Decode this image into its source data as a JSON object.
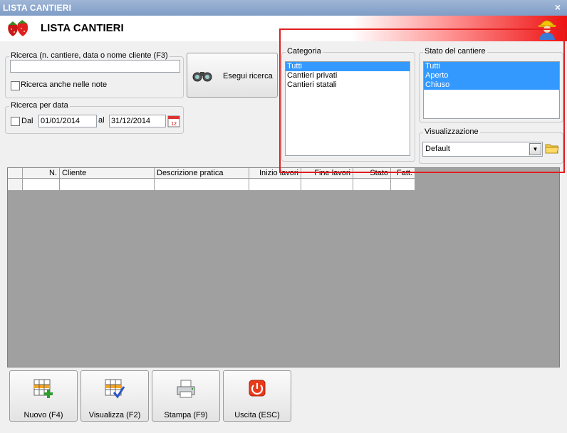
{
  "window": {
    "title": "LISTA CANTIERI",
    "close_glyph": "×"
  },
  "header": {
    "title": "LISTA CANTIERI",
    "logo_icon": "strawberries-icon",
    "user_icon": "worker-helmet-icon"
  },
  "search": {
    "legend": "Ricerca (n. cantiere, data o nome cliente (F3)",
    "value": "",
    "notes_checkbox_label": "Ricerca anche nelle note",
    "notes_checked": false,
    "button_label": "Esegui ricerca",
    "button_icon": "binoculars-icon"
  },
  "date_search": {
    "legend": "Ricerca per data",
    "dal_label": "Dal",
    "dal_checked": false,
    "from": "01/01/2014",
    "al_label": "al",
    "to": "31/12/2014",
    "calendar_icon": "calendar-icon"
  },
  "categoria": {
    "legend": "Categoria",
    "items": [
      {
        "label": "Tutti",
        "selected": true
      },
      {
        "label": "Cantieri privati",
        "selected": false
      },
      {
        "label": "Cantieri statali",
        "selected": false
      }
    ]
  },
  "stato": {
    "legend": "Stato del cantiere",
    "items": [
      {
        "label": "Tutti",
        "selected": true
      },
      {
        "label": "Aperto",
        "selected": true
      },
      {
        "label": "Chiuso",
        "selected": true
      }
    ]
  },
  "visualizzazione": {
    "legend": "Visualizzazione",
    "selected": "Default",
    "folder_icon": "folder-icon"
  },
  "table": {
    "columns": [
      "",
      "N.",
      "Cliente",
      "Descrizione pratica",
      "Inizio lavori",
      "Fine lavori",
      "Stato",
      "Fatt."
    ],
    "rows": []
  },
  "actions": [
    {
      "label": "Nuovo (F4)",
      "icon": "grid-add-icon"
    },
    {
      "label": "Visualizza (F2)",
      "icon": "grid-check-icon"
    },
    {
      "label": "Stampa (F9)",
      "icon": "printer-icon"
    },
    {
      "label": "Uscita (ESC)",
      "icon": "power-icon"
    }
  ],
  "colors": {
    "selection": "#3399ff",
    "highlight_box": "#e21e1e",
    "grid_bg": "#a0a0a0"
  }
}
